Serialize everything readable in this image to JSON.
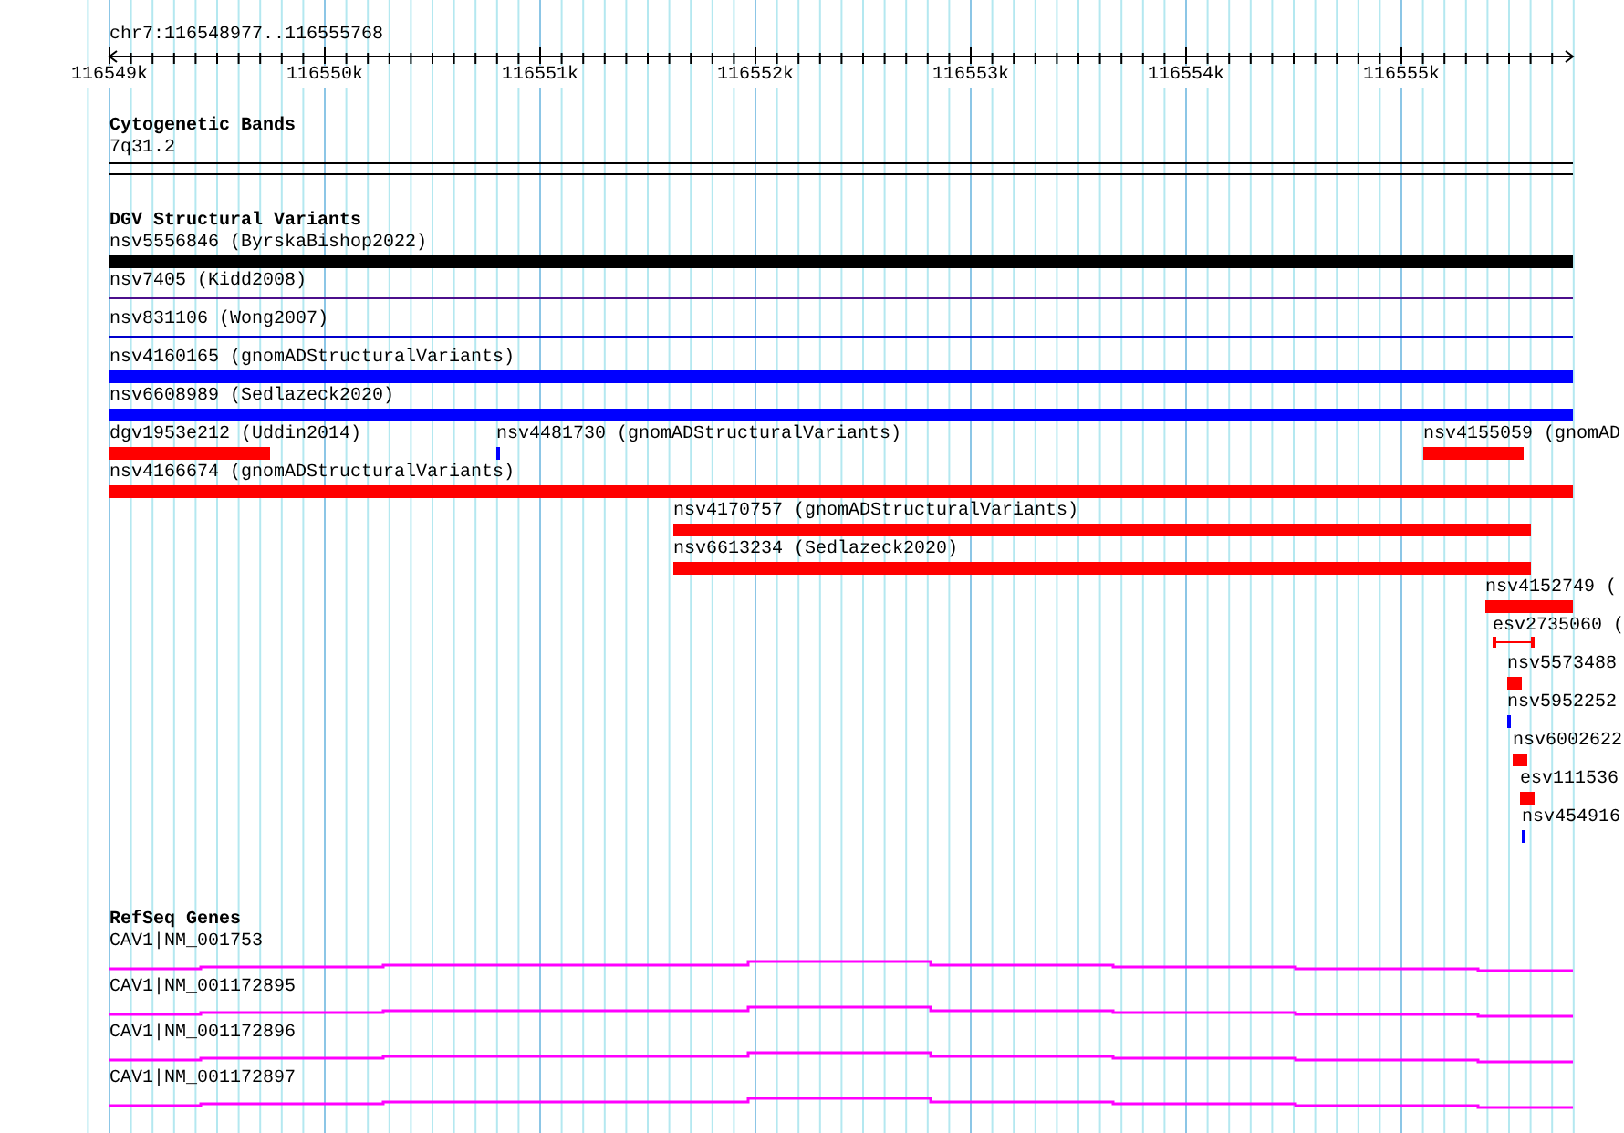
{
  "ruler": {
    "location": "chr7:116548977..116555768",
    "ticks": [
      "116549k",
      "116550k",
      "116551k",
      "116552k",
      "116553k",
      "116554k",
      "116555k"
    ]
  },
  "cytogenetic_track": {
    "title": "Cytogenetic Bands",
    "bands": [
      {
        "label": "7q31.2"
      }
    ]
  },
  "dgv_track": {
    "title": "DGV Structural Variants",
    "rows": [
      {
        "features": [
          {
            "label": "nsv5556846 (ByrskaBishop2022)",
            "kind": "bar",
            "color": "#000000"
          }
        ]
      },
      {
        "features": [
          {
            "label": "nsv7405 (Kidd2008)",
            "kind": "line",
            "color": "#4b0f8c"
          }
        ]
      },
      {
        "features": [
          {
            "label": "nsv831106 (Wong2007)",
            "kind": "line",
            "color": "#0000cc"
          }
        ]
      },
      {
        "features": [
          {
            "label": "nsv4160165 (gnomADStructuralVariants)",
            "kind": "bar",
            "color": "#0000ff"
          }
        ]
      },
      {
        "features": [
          {
            "label": "nsv6608989 (Sedlazeck2020)",
            "kind": "bar",
            "color": "#0000ff"
          }
        ]
      },
      {
        "features": [
          {
            "label": "dgv1953e212 (Uddin2014)",
            "kind": "bar",
            "color": "#ff0000"
          },
          {
            "label": "nsv4481730 (gnomADStructuralVariants)",
            "kind": "bar",
            "color": "#0000ff"
          },
          {
            "label": "nsv4155059 (gnomAD",
            "kind": "bar",
            "color": "#ff0000"
          }
        ]
      },
      {
        "features": [
          {
            "label": "nsv4166674 (gnomADStructuralVariants)",
            "kind": "bar",
            "color": "#ff0000"
          }
        ]
      },
      {
        "features": [
          {
            "label": "nsv4170757 (gnomADStructuralVariants)",
            "kind": "bar",
            "color": "#ff0000"
          }
        ]
      },
      {
        "features": [
          {
            "label": "nsv6613234 (Sedlazeck2020)",
            "kind": "bar",
            "color": "#ff0000"
          }
        ]
      },
      {
        "features": [
          {
            "label": "nsv4152749 (",
            "kind": "bar",
            "color": "#ff0000"
          }
        ]
      },
      {
        "features": [
          {
            "label": "esv2735060 (",
            "kind": "bracket",
            "color": "#ff0000"
          }
        ]
      },
      {
        "features": [
          {
            "label": "nsv5573488",
            "kind": "bar",
            "color": "#ff0000"
          }
        ]
      },
      {
        "features": [
          {
            "label": "nsv5952252",
            "kind": "bar",
            "color": "#0000ff"
          }
        ]
      },
      {
        "features": [
          {
            "label": "nsv6002622",
            "kind": "bar",
            "color": "#ff0000"
          }
        ]
      },
      {
        "features": [
          {
            "label": "esv111536",
            "kind": "bar",
            "color": "#ff0000"
          }
        ]
      },
      {
        "features": [
          {
            "label": "nsv454916",
            "kind": "bar",
            "color": "#0000ff"
          }
        ]
      }
    ]
  },
  "refseq_track": {
    "title": "RefSeq Genes",
    "genes": [
      {
        "label": "CAV1|NM_001753"
      },
      {
        "label": "CAV1|NM_001172895"
      },
      {
        "label": "CAV1|NM_001172896"
      },
      {
        "label": "CAV1|NM_001172897"
      }
    ]
  }
}
